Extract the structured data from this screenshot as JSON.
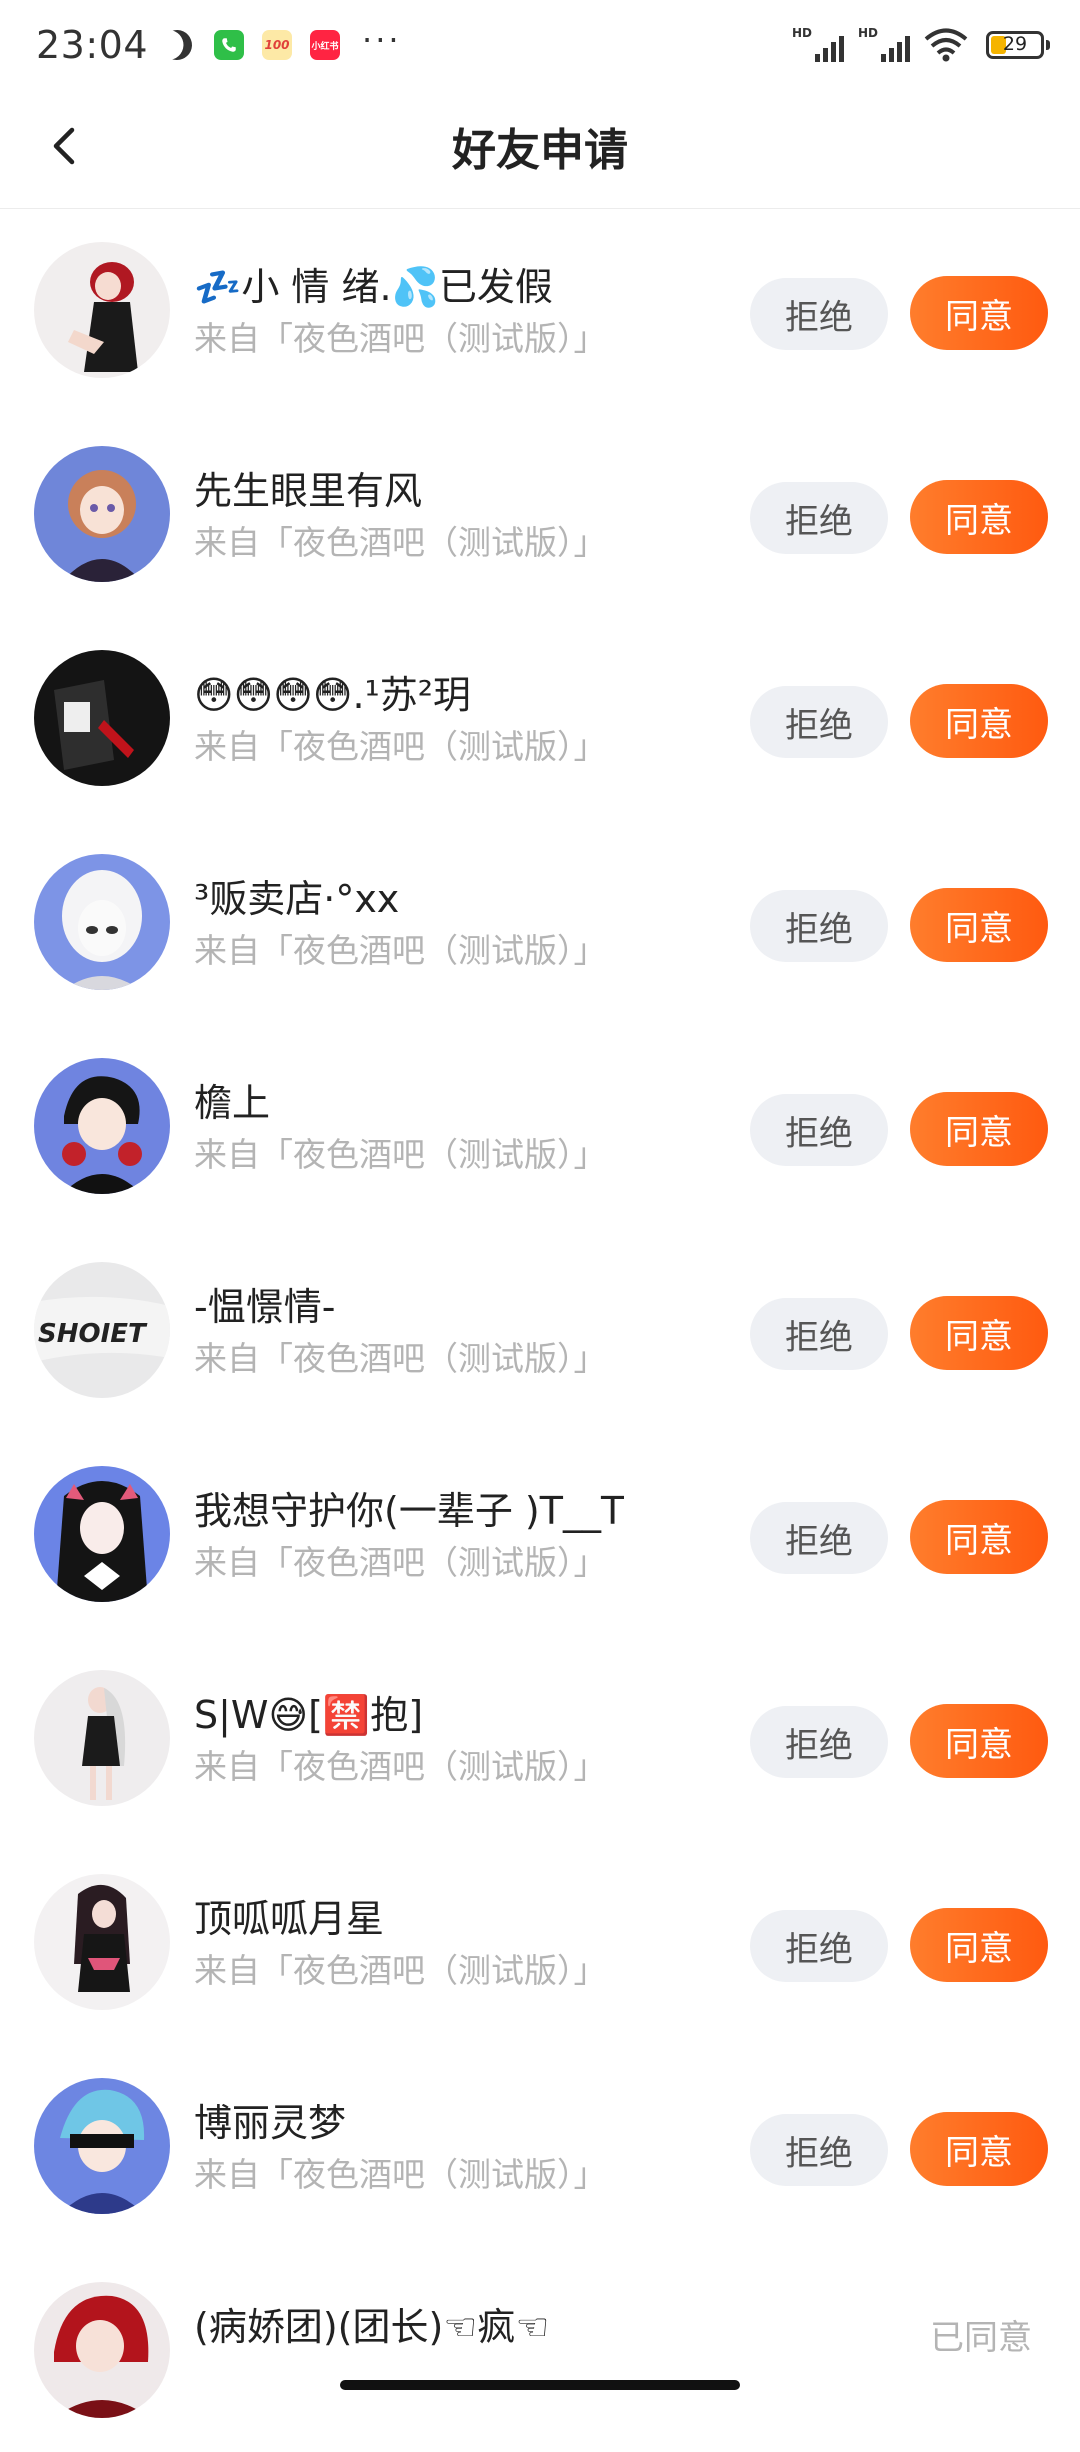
{
  "status_bar": {
    "time": "23:04",
    "battery": "29",
    "signal_label_1": "HD",
    "signal_label_2": "HD",
    "app_icons": [
      {
        "name": "phone-app-icon",
        "color": "#2fbf48"
      },
      {
        "name": "100-app-icon",
        "color": "#fde9a6",
        "label": "100"
      },
      {
        "name": "xiaohongshu-app-icon",
        "color": "#ff2442",
        "label": "小红书"
      }
    ],
    "more": "···"
  },
  "header": {
    "title": "好友申请"
  },
  "requests": [
    {
      "name": "💤小  情  绪.💦已发假",
      "source": "来自「夜色酒吧（测试版）」",
      "reject": "拒绝",
      "accept": "同意"
    },
    {
      "name": "先生眼里有风",
      "source": "来自「夜色酒吧（测试版）」",
      "reject": "拒绝",
      "accept": "同意"
    },
    {
      "name": "😳😳😳😳.¹苏²玥",
      "source": "来自「夜色酒吧（测试版）」",
      "reject": "拒绝",
      "accept": "同意"
    },
    {
      "name": "³贩卖店·°xx",
      "source": "来自「夜色酒吧（测试版）」",
      "reject": "拒绝",
      "accept": "同意"
    },
    {
      "name": "檐上",
      "source": "来自「夜色酒吧（测试版）」",
      "reject": "拒绝",
      "accept": "同意"
    },
    {
      "name": "-愠憬情-",
      "source": "来自「夜色酒吧（测试版）」",
      "reject": "拒绝",
      "accept": "同意"
    },
    {
      "name": "我想守护你(一辈子 )T__T",
      "source": "来自「夜色酒吧（测试版）」",
      "reject": "拒绝",
      "accept": "同意"
    },
    {
      "name": "S|W😅[🈲抱]",
      "source": "来自「夜色酒吧（测试版）」",
      "reject": "拒绝",
      "accept": "同意"
    },
    {
      "name": "顶呱呱月星",
      "source": "来自「夜色酒吧（测试版）」",
      "reject": "拒绝",
      "accept": "同意"
    },
    {
      "name": "博丽灵梦",
      "source": "来自「夜色酒吧（测试版）」",
      "reject": "拒绝",
      "accept": "同意"
    },
    {
      "name": "(病娇团)(团长)☜疯☜",
      "source": "",
      "status": "已同意"
    }
  ],
  "colors": {
    "accent": "#ff6a1a",
    "reject_bg": "#eef0f4",
    "muted_text": "#b4b4b4"
  }
}
